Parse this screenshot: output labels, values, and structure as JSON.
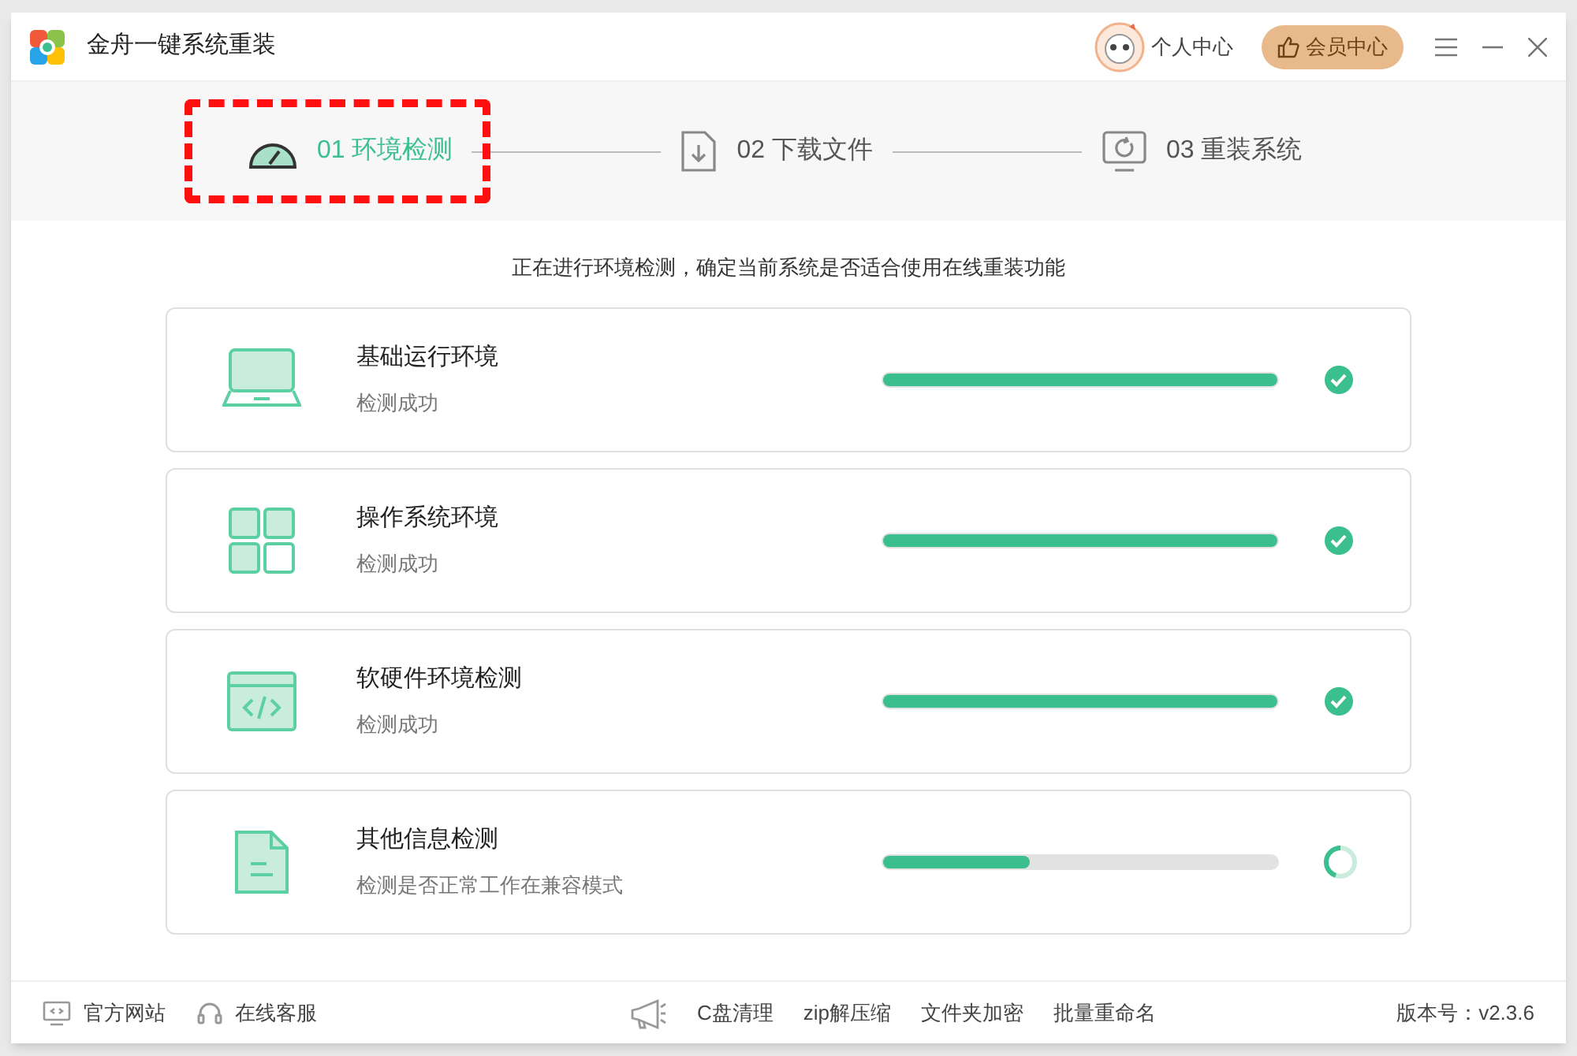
{
  "window": {
    "title": "金舟一键系统重装"
  },
  "header": {
    "user_center": "个人中心",
    "member_center": "会员中心"
  },
  "steps": [
    {
      "label": "01 环境检测",
      "selected": true
    },
    {
      "label": "02 下载文件",
      "selected": false
    },
    {
      "label": "03 重装系统",
      "selected": false
    }
  ],
  "intro": "正在进行环境检测，确定当前系统是否适合使用在线重装功能",
  "checks": [
    {
      "title": "基础运行环境",
      "status_text": "检测成功",
      "level": 1,
      "done": true
    },
    {
      "title": "操作系统环境",
      "status_text": "检测成功",
      "level": 1,
      "done": true
    },
    {
      "title": "软硬件环境检测",
      "status_text": "检测成功",
      "level": 1,
      "done": true
    },
    {
      "title": "其他信息检测",
      "status_text": "检测是否正常工作在兼容模式",
      "level": 0.37,
      "done": false
    }
  ],
  "footer": {
    "left": [
      "官方网站",
      "在线客服"
    ],
    "tools": [
      "C盘清理",
      "zip解压缩",
      "文件夹加密",
      "批量重命名"
    ],
    "version": "版本号：v2.3.6"
  }
}
